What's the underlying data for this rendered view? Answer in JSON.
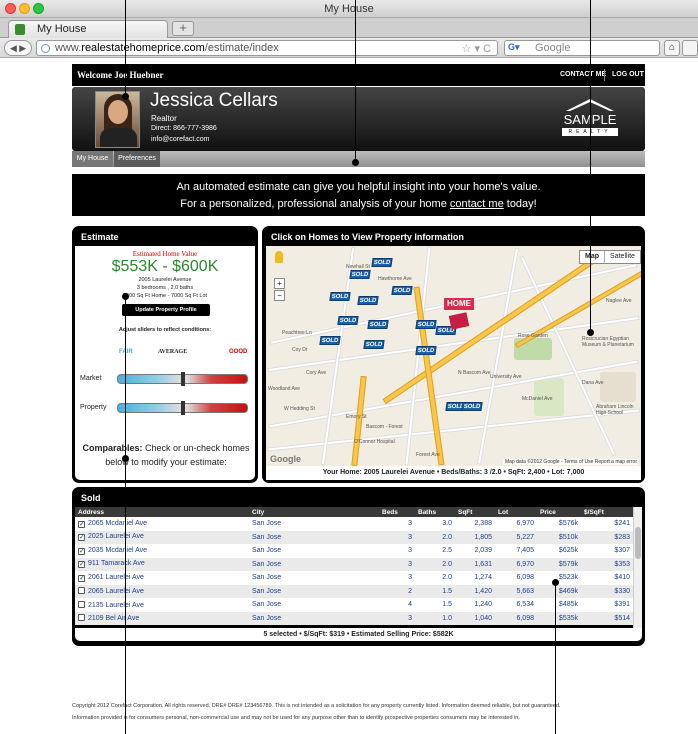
{
  "browser": {
    "window_title": "My House",
    "tab_label": "My House",
    "url_prefix": "www.",
    "url_domain": "realestatehomeprice.com",
    "url_path": "/estimate/index",
    "search_placeholder": "Google",
    "new_tab": "+"
  },
  "site": {
    "welcome": "Welcome Joe Huebner",
    "contact_me": "CONTACT ME",
    "logout": "LOG OUT",
    "agent": {
      "name": "Jessica Cellars",
      "title": "Realtor",
      "phone": "Direct: 866-777-3986",
      "email": "info@corefact.com"
    },
    "logo": {
      "word": "SAMPLE",
      "sub": "REALTY"
    },
    "tabs": [
      "My House",
      "Preferences"
    ],
    "banner": {
      "line1": "An automated estimate can give you helpful insight into your home's value.",
      "line2_pre": "For a personalized, professional analysis of your home ",
      "line2_link": "contact me",
      "line2_post": " today!"
    }
  },
  "estimate": {
    "title": "Estimate",
    "label": "Estimated Home Value",
    "range": "$553K - $600K",
    "address": "2005 Laurelei Avenue",
    "beds_baths": "3 bedrooms , 2.0 baths",
    "sqft_lot": "2400 Sq Ft Home - 7000 Sq Ft Lot",
    "update_button": "Update Property Profile",
    "adjust_hint": "Adjust sliders to reflect conditions:",
    "scale": {
      "fair": "FAIR",
      "average": "AVERAGE",
      "good": "GOOD"
    },
    "sliders": [
      {
        "label": "Market",
        "level": 0.5
      },
      {
        "label": "Property",
        "level": 0.5
      }
    ],
    "comparables_bold": "Comparables:",
    "comparables_text": " Check or un-check homes below to modify your estimate:"
  },
  "map": {
    "title": "Click on Homes to View Property Information",
    "map_button": "Map",
    "satellite_button": "Satellite",
    "home_label": "HOME",
    "sold_label": "SOLD",
    "streets": [
      "Newhall St",
      "Hawthorne Ave",
      "Peachtree Ln",
      "Coy Dr",
      "Cory Ave",
      "Woodland Ave",
      "W Hedding St",
      "Emory St",
      "Bascom - Forest",
      "O'Connor Hospital",
      "Forest Ave",
      "Rose Garden",
      "Rosicrucian Egyptian Museum & Planetarium",
      "Abraham Lincoln High School",
      "McDaniel Ave",
      "University Ave",
      "Naglee Ave",
      "Dana Ave",
      "N Bascom Ave"
    ],
    "google": "Google",
    "credit": "Map data ©2012 Google - Terms of Use  Report a map error",
    "footer": "Your Home: 2005 Laurelei Avenue  •  Beds/Baths: 3 /2.0  •  SqFt: 2,400  •  Lot: 7,000"
  },
  "sold": {
    "title": "Sold",
    "columns": [
      "Address",
      "City",
      "Beds",
      "Baths",
      "SqFt",
      "Lot",
      "Price",
      "$/SqFt"
    ],
    "rows": [
      {
        "checked": true,
        "address": "2065 Mcdaniel Ave",
        "city": "San Jose",
        "beds": "3",
        "baths": "3.0",
        "sqft": "2,388",
        "lot": "6,970",
        "price": "$576k",
        "psf": "$241"
      },
      {
        "checked": true,
        "address": "2025 Laurelei Ave",
        "city": "San Jose",
        "beds": "3",
        "baths": "2.0",
        "sqft": "1,805",
        "lot": "5,227",
        "price": "$510k",
        "psf": "$283"
      },
      {
        "checked": true,
        "address": "2035 Mcdaniel Ave",
        "city": "San Jose",
        "beds": "3",
        "baths": "2.5",
        "sqft": "2,039",
        "lot": "7,405",
        "price": "$625k",
        "psf": "$307"
      },
      {
        "checked": true,
        "address": "911 Tamarack Ave",
        "city": "San Jose",
        "beds": "3",
        "baths": "2.0",
        "sqft": "1,631",
        "lot": "6,970",
        "price": "$579k",
        "psf": "$353"
      },
      {
        "checked": true,
        "address": "2061 Laurelei Ave",
        "city": "San Jose",
        "beds": "3",
        "baths": "2.0",
        "sqft": "1,274",
        "lot": "6,098",
        "price": "$523k",
        "psf": "$410"
      },
      {
        "checked": false,
        "address": "2065 Laurelei Ave",
        "city": "San Jose",
        "beds": "2",
        "baths": "1.5",
        "sqft": "1,420",
        "lot": "5,663",
        "price": "$469k",
        "psf": "$330"
      },
      {
        "checked": false,
        "address": "2135 Laurelei Ave",
        "city": "San Jose",
        "beds": "4",
        "baths": "1.5",
        "sqft": "1,240",
        "lot": "6,534",
        "price": "$485k",
        "psf": "$391"
      },
      {
        "checked": false,
        "address": "2109 Bel Air Ave",
        "city": "San Jose",
        "beds": "3",
        "baths": "1.0",
        "sqft": "1,040",
        "lot": "6,098",
        "price": "$535k",
        "psf": "$514"
      }
    ],
    "summary": "5  selected • $/SqFt: $319  • Estimated Selling Price:  $582K"
  },
  "footer": {
    "line1": "Copyright 2012 Corefact Corporation. All rights reserved. DRE# DRE# 123456789. This is not intended as a solicitation for any property currently listed. Information deemed reliable, but not guaranteed.",
    "line2": "Information provided is for consumers personal, non-commercial use and may not be used for any purpose other than to identify prospective properties consumers may be interested in."
  }
}
